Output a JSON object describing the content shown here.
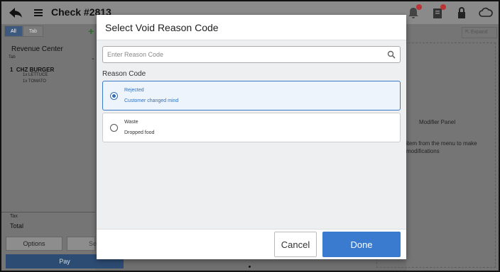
{
  "app": {
    "title": "Check #2813",
    "icons": {
      "back": "back-arrow-icon",
      "menu": "hamburger-menu-icon",
      "notifications": "bell-icon",
      "orders": "clipboard-icon",
      "lock": "lock-icon",
      "cloud": "cloud-icon"
    }
  },
  "left_panel": {
    "tabs": [
      {
        "label": "All"
      },
      {
        "label": "Tab"
      }
    ],
    "revenue_center_label": "Revenue Center",
    "revenue_center_value": "Tab",
    "order_item": {
      "qty": "1",
      "name": "CHZ BURGER",
      "modifiers": [
        "1x LETTUCE",
        "1x TOMATO"
      ]
    },
    "tax_label": "Tax",
    "total_label": "Total",
    "options_label": "Options",
    "send_label": "Se",
    "pay_label": "Pay"
  },
  "right_panel": {
    "expand_label": "Expand",
    "modifier_title": "Modifier Panel",
    "modifier_desc": "item from the menu to make modifications"
  },
  "modal": {
    "title": "Select Void Reason Code",
    "search_placeholder": "Enter Reason Code",
    "section_label": "Reason Code",
    "options": [
      {
        "name": "Rejected",
        "description": "Customer changed mind",
        "selected": true
      },
      {
        "name": "Waste",
        "description": "Dropped food",
        "selected": false
      }
    ],
    "cancel_label": "Cancel",
    "done_label": "Done"
  },
  "colors": {
    "accent": "#3a7bd0",
    "selected_border": "#3b7ac8",
    "overlay": "#6f6f6f"
  }
}
